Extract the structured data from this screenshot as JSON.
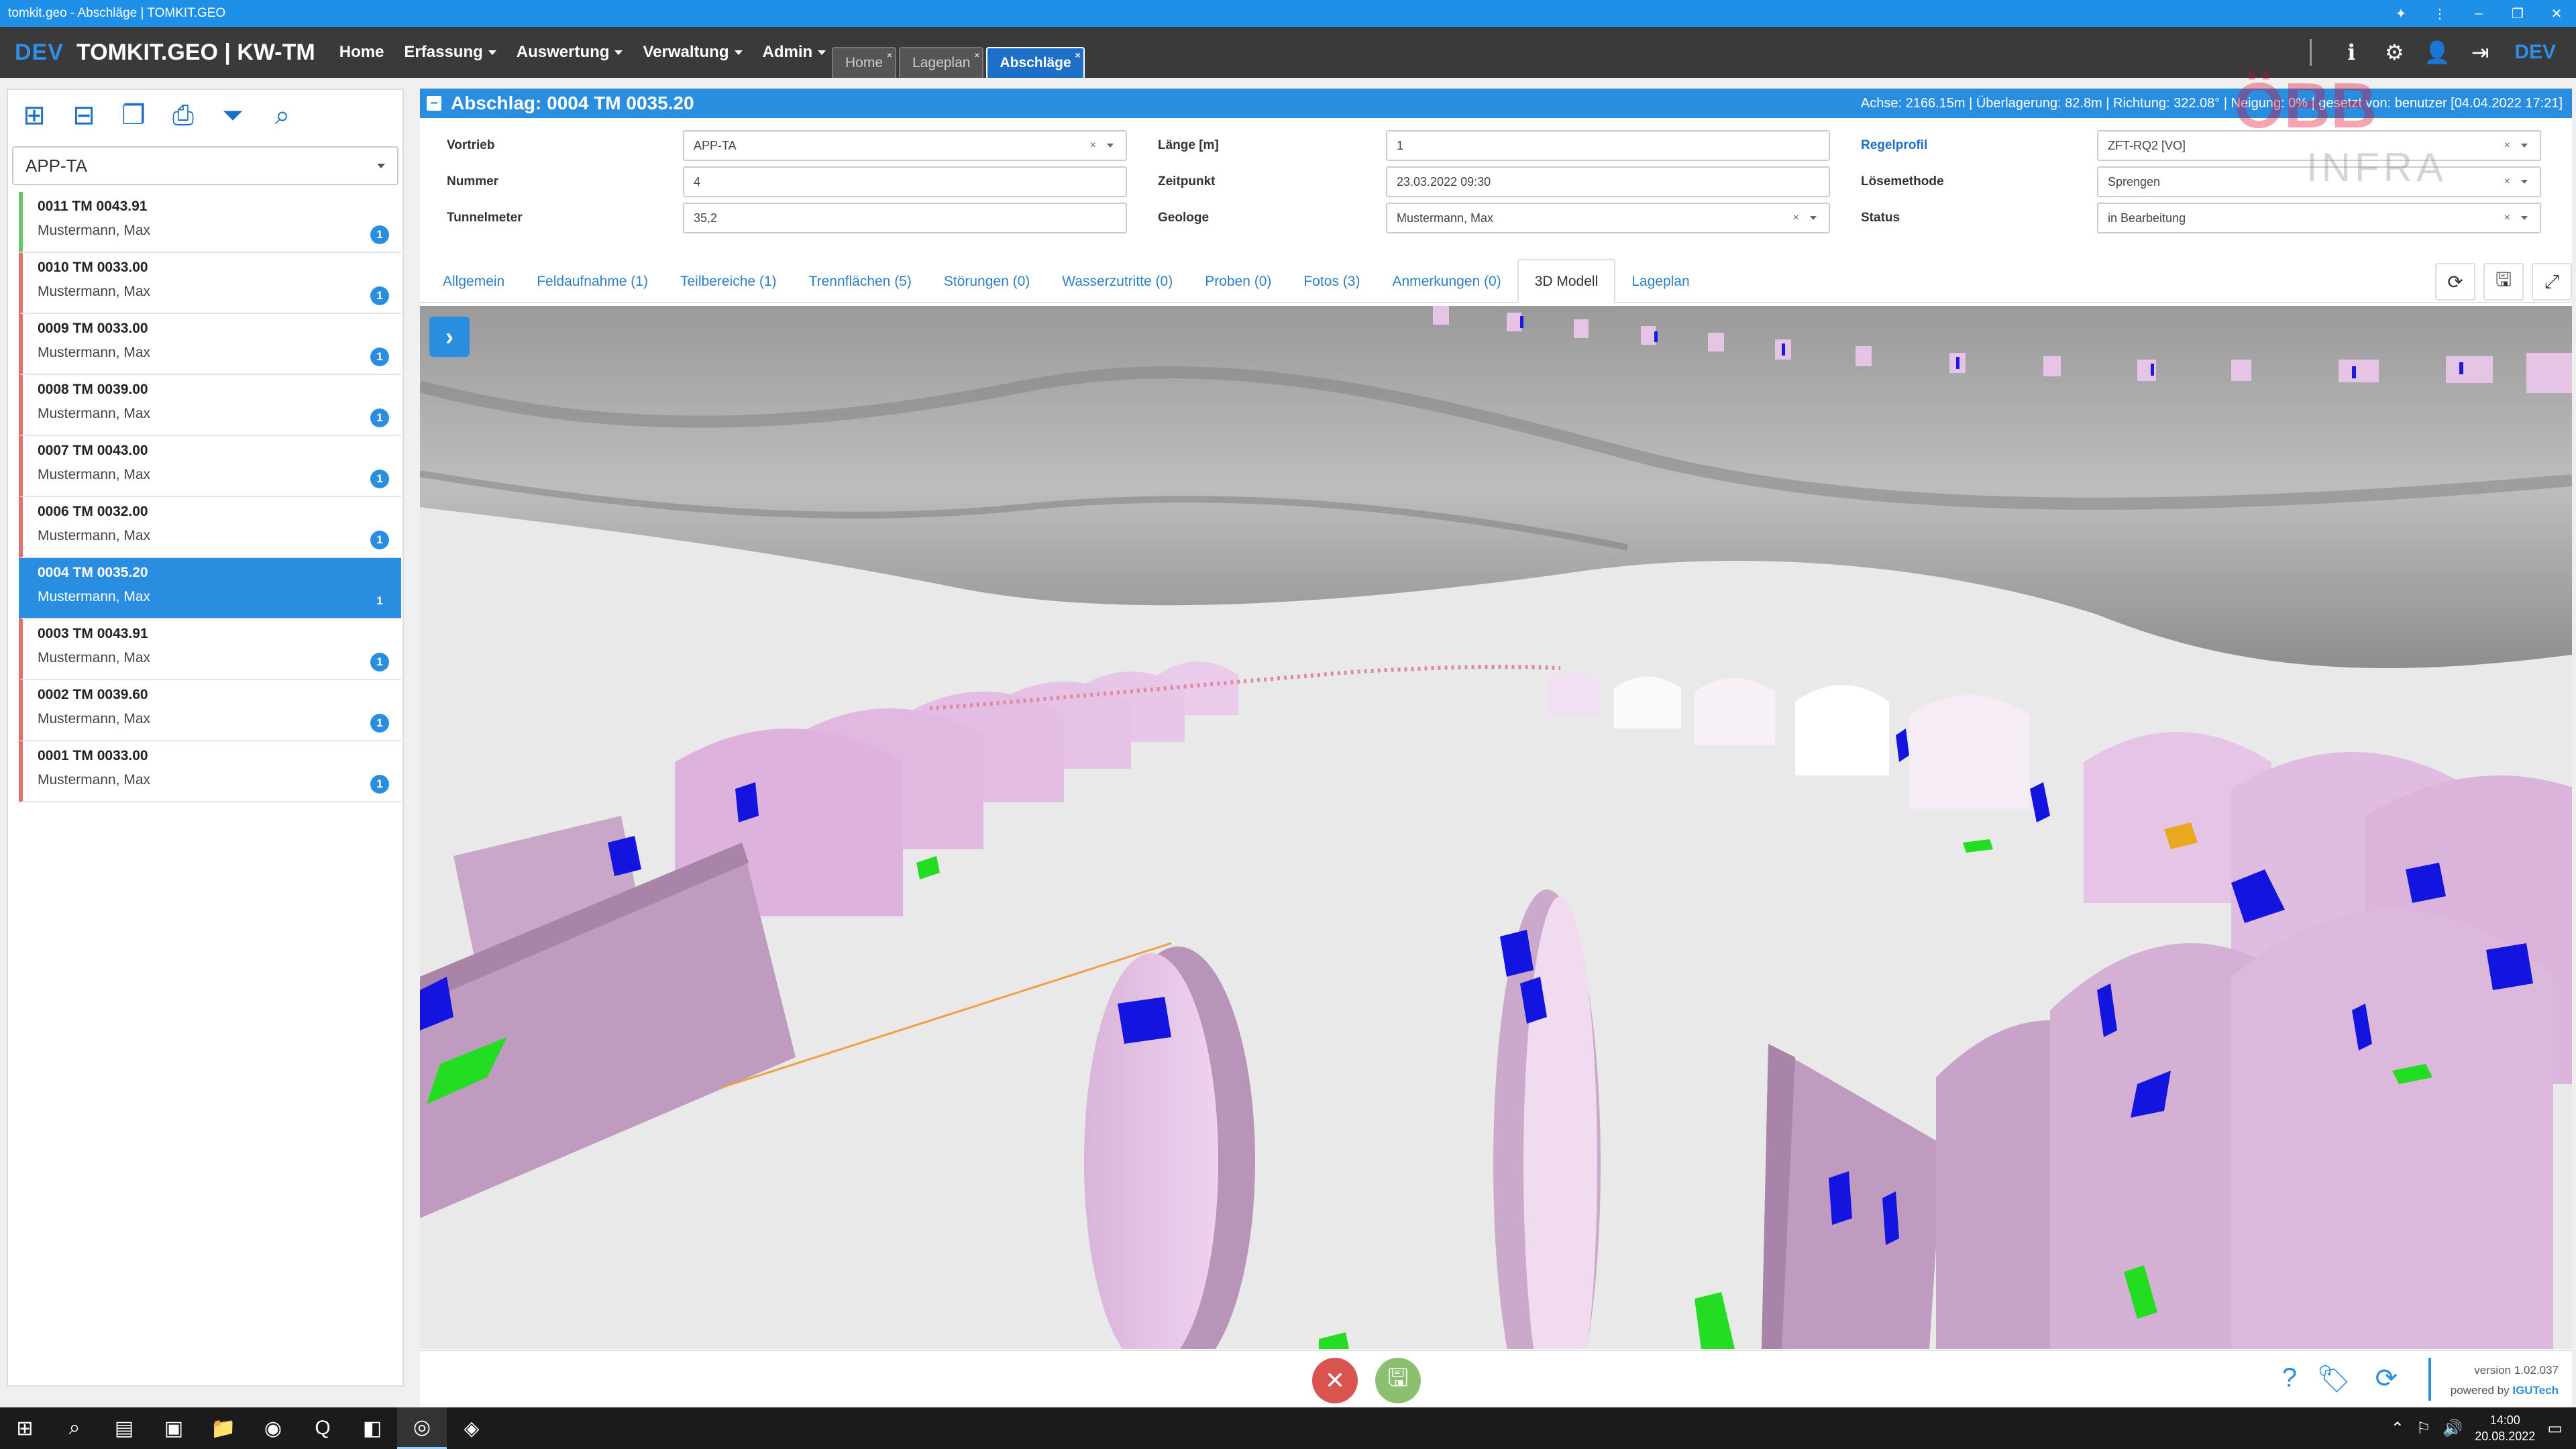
{
  "window": {
    "title": "tomkit.geo - Abschläge | TOMKIT.GEO",
    "pin_icon": "pin-icon",
    "controls": [
      "more-icon",
      "minimize-icon",
      "maximize-icon",
      "close-icon"
    ]
  },
  "navbar": {
    "env_label": "DEV",
    "brand": "TOMKIT.GEO | KW-TM",
    "menu": [
      {
        "label": "Home",
        "dropdown": false
      },
      {
        "label": "Erfassung",
        "dropdown": true
      },
      {
        "label": "Auswertung",
        "dropdown": true
      },
      {
        "label": "Verwaltung",
        "dropdown": true
      },
      {
        "label": "Admin",
        "dropdown": true
      }
    ],
    "open_tabs": [
      {
        "label": "Home",
        "active": false
      },
      {
        "label": "Lageplan",
        "active": false
      },
      {
        "label": "Abschläge",
        "active": true
      }
    ],
    "right_icons": [
      "info-icon",
      "gear-icon",
      "user-icon",
      "logout-icon"
    ],
    "env_label_right": "DEV"
  },
  "sidebar": {
    "tools": [
      "add-icon",
      "remove-icon",
      "copy-icon",
      "print-icon",
      "filter-icon",
      "search-icon"
    ],
    "selector_value": "APP-TA",
    "items": [
      {
        "title": "0011 TM 0043.91",
        "subtitle": "Mustermann, Max",
        "badge": "1",
        "status": "green",
        "active": false
      },
      {
        "title": "0010 TM 0033.00",
        "subtitle": "Mustermann, Max",
        "badge": "1",
        "status": "red",
        "active": false
      },
      {
        "title": "0009 TM 0033.00",
        "subtitle": "Mustermann, Max",
        "badge": "1",
        "status": "red",
        "active": false
      },
      {
        "title": "0008 TM 0039.00",
        "subtitle": "Mustermann, Max",
        "badge": "1",
        "status": "red",
        "active": false
      },
      {
        "title": "0007 TM 0043.00",
        "subtitle": "Mustermann, Max",
        "badge": "1",
        "status": "red",
        "active": false
      },
      {
        "title": "0006 TM 0032.00",
        "subtitle": "Mustermann, Max",
        "badge": "1",
        "status": "red",
        "active": false
      },
      {
        "title": "0004 TM 0035.20",
        "subtitle": "Mustermann, Max",
        "badge": "1",
        "status": "blue",
        "active": true
      },
      {
        "title": "0003 TM 0043.91",
        "subtitle": "Mustermann, Max",
        "badge": "1",
        "status": "red",
        "active": false
      },
      {
        "title": "0002 TM 0039.60",
        "subtitle": "Mustermann, Max",
        "badge": "1",
        "status": "red",
        "active": false
      },
      {
        "title": "0001 TM 0033.00",
        "subtitle": "Mustermann, Max",
        "badge": "1",
        "status": "red",
        "active": false
      }
    ]
  },
  "panel": {
    "title": "Abschlag: 0004 TM 0035.20",
    "info": "Achse: 2166.15m | Überlagerung: 82.8m | Richtung: 322.08° | Neigung: 0% | gesetzt von: benutzer [04.04.2022 17:21]",
    "fields": {
      "vortrieb": {
        "label": "Vortrieb",
        "value": "APP-TA"
      },
      "nummer": {
        "label": "Nummer",
        "value": "4"
      },
      "tunnelmeter": {
        "label": "Tunnelmeter",
        "value": "35,2"
      },
      "laenge": {
        "label": "Länge [m]",
        "value": "1"
      },
      "zeitpunkt": {
        "label": "Zeitpunkt",
        "value": "23.03.2022 09:30"
      },
      "geologe": {
        "label": "Geologe",
        "value": "Mustermann, Max"
      },
      "regelprofil": {
        "label": "Regelprofil",
        "value": "ZFT-RQ2 [VO]"
      },
      "loesemethode": {
        "label": "Lösemethode",
        "value": "Sprengen"
      },
      "status": {
        "label": "Status",
        "value": "in Bearbeitung"
      }
    },
    "tabs": [
      {
        "label": "Allgemein",
        "active": false
      },
      {
        "label": "Feldaufnahme (1)",
        "active": false
      },
      {
        "label": "Teilbereiche (1)",
        "active": false
      },
      {
        "label": "Trennflächen (5)",
        "active": false
      },
      {
        "label": "Störungen (0)",
        "active": false
      },
      {
        "label": "Wasserzutritte (0)",
        "active": false
      },
      {
        "label": "Proben (0)",
        "active": false
      },
      {
        "label": "Fotos (3)",
        "active": false
      },
      {
        "label": "Anmerkungen (0)",
        "active": false
      },
      {
        "label": "3D Modell",
        "active": true
      },
      {
        "label": "Lageplan",
        "active": false
      }
    ],
    "tab_tools": [
      "refresh-icon",
      "save-icon",
      "fullscreen-icon"
    ]
  },
  "logo": {
    "line1": "ÖBB",
    "line2": "INFRA",
    "color": "#e2002a"
  },
  "footer": {
    "version": "version 1.02.037",
    "powered_prefix": "powered by ",
    "powered_brand": "IGUTech",
    "icons": [
      "help-icon",
      "tags-icon",
      "sync-icon"
    ]
  },
  "taskbar": {
    "time": "14:00",
    "date": "20.08.2022",
    "apps": [
      "windows-icon",
      "search-icon",
      "taskview-icon",
      "app-icon",
      "explorer-icon",
      "chrome-icon",
      "qgis-icon",
      "app-icon",
      "tomkit-icon",
      "app-icon"
    ]
  },
  "colors": {
    "accent": "#2a8ee0",
    "navbar": "#3a3a3a",
    "titlebar": "#1e90e8",
    "ring_pink": "#e6c4e6",
    "marker_blue": "#1a1ae6",
    "marker_green": "#22dd22"
  }
}
